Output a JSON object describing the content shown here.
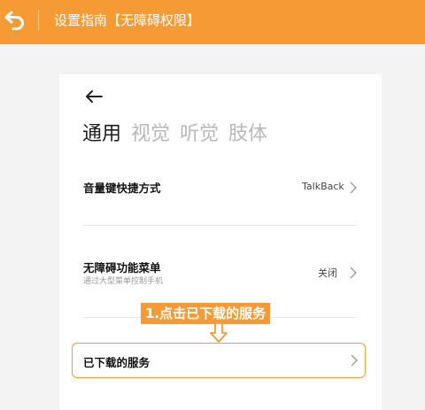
{
  "topbar": {
    "title": "设置指南【无障碍权限】"
  },
  "screen": {
    "tabs": [
      {
        "label": "通用",
        "active": true
      },
      {
        "label": "视觉",
        "active": false
      },
      {
        "label": "听觉",
        "active": false
      },
      {
        "label": "肢体",
        "active": false
      }
    ],
    "rows": [
      {
        "title": "音量键快捷方式",
        "value": "TalkBack"
      },
      {
        "title": "无障碍功能菜单",
        "subtitle": "通过大型菜单控制手机",
        "value": "关闭"
      },
      {
        "title": "已下载的服务"
      }
    ]
  },
  "guide": {
    "step_label": "1.点击已下载的服务"
  },
  "colors": {
    "accent": "#f59a35",
    "background": "#f3f3f3",
    "card": "#ffffff"
  },
  "icons": {
    "topbar_back": "return-arrow-icon",
    "screen_back": "left-arrow-icon",
    "row_chevron": "chevron-right-icon",
    "guide_arrow": "down-arrow-icon"
  }
}
